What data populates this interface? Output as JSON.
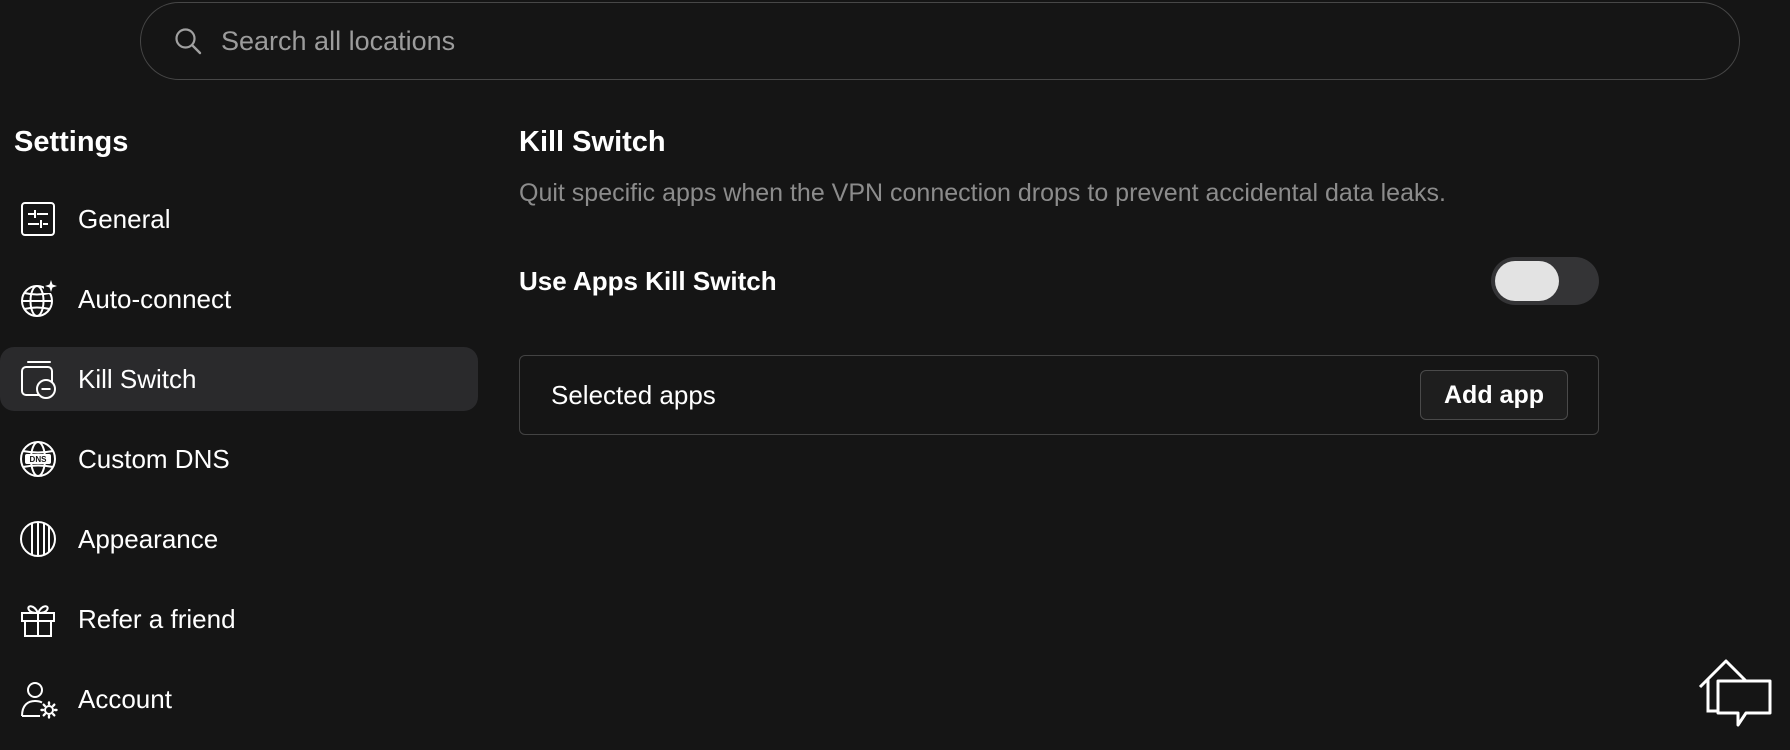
{
  "search": {
    "placeholder": "Search all locations",
    "value": ""
  },
  "sidebar": {
    "title": "Settings",
    "items": [
      {
        "label": "General",
        "icon": "sliders-icon",
        "active": false
      },
      {
        "label": "Auto-connect",
        "icon": "globe-sparkle-icon",
        "active": false
      },
      {
        "label": "Kill Switch",
        "icon": "kill-switch-icon",
        "active": true
      },
      {
        "label": "Custom DNS",
        "icon": "globe-dns-icon",
        "active": false
      },
      {
        "label": "Appearance",
        "icon": "appearance-icon",
        "active": false
      },
      {
        "label": "Refer a friend",
        "icon": "gift-icon",
        "active": false
      },
      {
        "label": "Account",
        "icon": "user-gear-icon",
        "active": false
      }
    ]
  },
  "content": {
    "title": "Kill Switch",
    "description": "Quit specific apps when the VPN connection drops to prevent accidental data leaks.",
    "toggle": {
      "label": "Use Apps Kill Switch",
      "on": false
    },
    "apps": {
      "label": "Selected apps",
      "add_label": "Add app"
    }
  },
  "colors": {
    "background": "#151515",
    "active_item": "#2a2a2c",
    "border": "#434343",
    "muted_text": "#8c8c8c"
  }
}
